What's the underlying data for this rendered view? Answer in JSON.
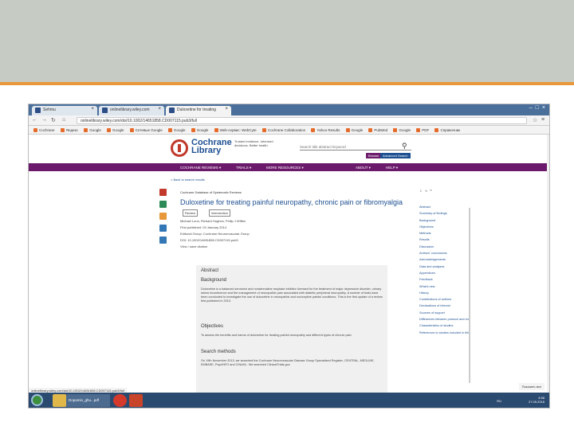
{
  "browser": {
    "tabs": [
      {
        "label": "Sehmu"
      },
      {
        "label": "onlinelibrary.wiley.com"
      },
      {
        "label": "Duloxetine for treating"
      }
    ],
    "url": "onlinelibrary.wiley.com/doi/10.1002/14651858.CD007115.pub3/full",
    "bookmarks": [
      "Cochrane",
      "Яндекс",
      "Google",
      "Google",
      "Сетевые Google",
      "Google",
      "Google",
      "Web-сервис: WebCyte",
      "Cochrane Collaboration",
      "Yahoo Results",
      "Google",
      "PubMed",
      "Google",
      "PDF",
      "Справочник"
    ]
  },
  "site": {
    "logo_line1": "Cochrane",
    "logo_line2": "Library",
    "tagline": "Trusted evidence. Informed decisions. Better health.",
    "search_placeholder": "Search title abstract keyword",
    "browse_label": "Browse",
    "advanced_label": "Advanced Search",
    "nav": [
      "COCHRANE REVIEWS ▾",
      "TRIALS ▾",
      "MORE RESOURCES ▾",
      "ABOUT ▾",
      "HELP ▾"
    ],
    "breadcrumb": "< Back to search results"
  },
  "article": {
    "type": "Cochrane Database of Systematic Reviews",
    "title": "Duloxetine for treating painful neuropathy, chronic pain or fibromyalgia",
    "btn_review": "Review",
    "btn_protocol": "Intervention",
    "authors": "Michael Lunn, Richard Hughes, Philip J Wiffen",
    "first_published": "First published: 03 January 2014",
    "editorial_group": "Editorial Group: Cochrane Neuromuscular Group",
    "doi": "DOI: 10.1002/14651858.CD007115.pub3",
    "view_link": "View / save citation"
  },
  "abstract": {
    "heading": "Abstract",
    "background_h": "Background",
    "background_p": "Duloxetine is a balanced serotonin and noradrenaline reuptake inhibitor licensed for the treatment of major depressive disorder, urinary stress incontinence and the management of neuropathic pain associated with diabetic peripheral neuropathy. A number of trials have been conducted to investigate the use of duloxetine in neuropathic and nociceptive painful conditions. This is the first update of a review first published in 2010.",
    "objectives_h": "Objectives",
    "objectives_p": "To assess the benefits and harms of duloxetine for treating painful neuropathy and different types of chronic pain.",
    "search_h": "Search methods",
    "search_p": "On 19th November 2013, we searched the Cochrane Neuromuscular Disease Group Specialized Register, CENTRAL, MEDLINE, EMBASE, PsycINFO and CINAHL. We searched ClinicalTrials.gov."
  },
  "contents": [
    "Abstract",
    "Summary of findings",
    "Background",
    "Objectives",
    "Methods",
    "Results",
    "Discussion",
    "Authors' conclusions",
    "Acknowledgements",
    "Data and analyses",
    "Appendices",
    "Feedback",
    "What's new",
    "History",
    "Contributions of authors",
    "Declarations of interest",
    "Sources of support",
    "Differences between protocol and review",
    "Characteristics of studies",
    "References to studies included in this review"
  ],
  "status_link": "onlinelibrary.wiley.com/doi/10.1002/14651858.CD007115.pub3/full",
  "taskbar": {
    "file_label": "Dopamin_ghu...pdf",
    "lang": "RU",
    "time": "4:58",
    "date": "27.05.2016",
    "notice": "Показать все"
  },
  "colors": {
    "nav_purple": "#6b1a6b",
    "brand_blue": "#1d4f91",
    "accent_orange": "#e8983a"
  }
}
